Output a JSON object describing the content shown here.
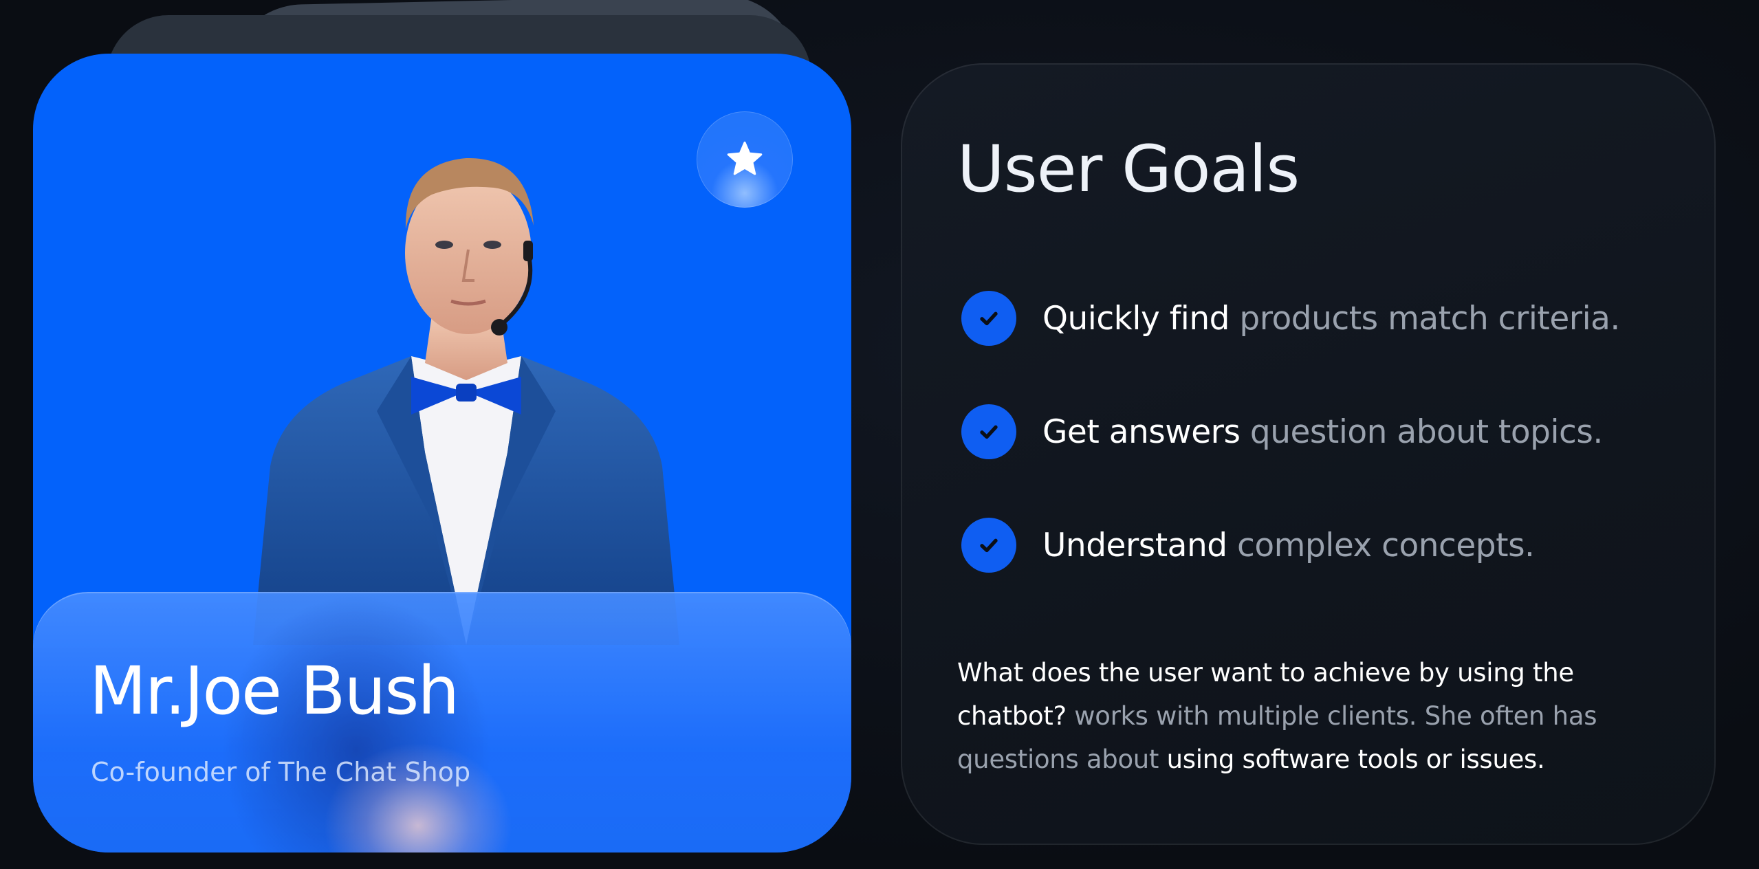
{
  "profile": {
    "name": "Mr.Joe Bush",
    "role": "Co-founder of The Chat Shop",
    "favorite_icon": "star-icon",
    "accent": "#0362fb"
  },
  "goals": {
    "title": "User Goals",
    "items": [
      {
        "bold": "Quickly find",
        "rest": " products match criteria."
      },
      {
        "bold": "Get answers",
        "rest": " question about  topics."
      },
      {
        "bold": "Understand",
        "rest": " complex concepts."
      }
    ],
    "description": {
      "part1": "What does the user want to achieve by using the chatbot?",
      "part2": " works with multiple clients. She often has questions about ",
      "part3": "using software tools or issues."
    },
    "check_icon": "check-icon",
    "check_color": "#0f5ef2"
  }
}
